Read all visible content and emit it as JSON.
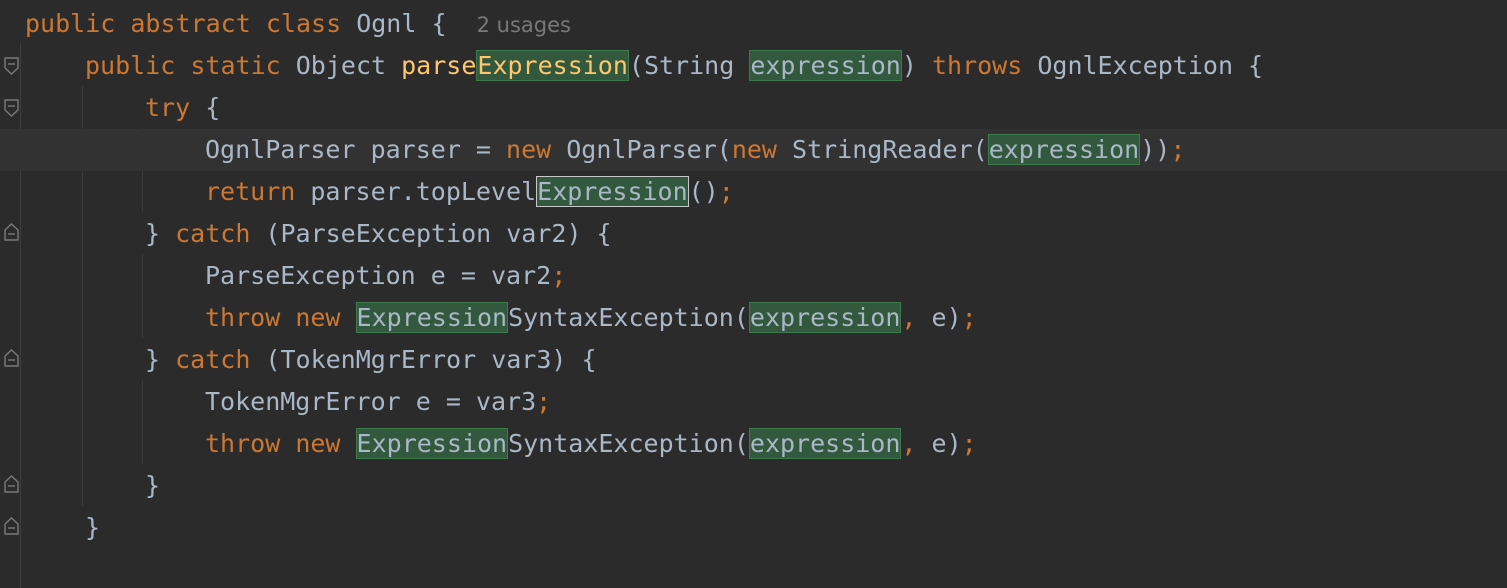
{
  "editor": {
    "class_line": {
      "kw1": "public",
      "kw2": "abstract",
      "kw3": "class",
      "name": "Ognl",
      "brace": "{",
      "usages": "2 usages"
    },
    "method_line": {
      "kw1": "public",
      "kw2": "static",
      "type": "Object",
      "fn_part1": "parse",
      "fn_part2": "Expression",
      "paren_open": "(String ",
      "param": "expression",
      "paren_close": ")",
      "kw_throws": "throws",
      "exc": "OgnlException {"
    },
    "try_line": {
      "kw": "try",
      "brace": "{"
    },
    "parser_line": {
      "p1": "OgnlParser parser = ",
      "kw_new1": "new",
      "p2": " OgnlParser(",
      "kw_new2": "new",
      "p3": " StringReader(",
      "arg": "expression",
      "p4": "))",
      "semi": ";"
    },
    "return_line": {
      "kw": "return",
      "p1": " parser.topLevel",
      "hl": "Expression",
      "p2": "()",
      "semi": ";"
    },
    "catch1_line": {
      "brace": "} ",
      "kw": "catch",
      "rest": " (ParseException var2) {"
    },
    "pe_line": {
      "text": "ParseException e = var2",
      "semi": ";"
    },
    "throw1_line": {
      "kw_throw": "throw",
      "kw_new": "new",
      "hl": "Expression",
      "p1": "SyntaxException(",
      "arg": "expression",
      "comma": ",",
      "p2": " e)",
      "semi": ";"
    },
    "catch2_line": {
      "brace": "} ",
      "kw": "catch",
      "rest": " (TokenMgrError var3) {"
    },
    "tme_line": {
      "text": "TokenMgrError e = var3",
      "semi": ";"
    },
    "throw2_line": {
      "kw_throw": "throw",
      "kw_new": "new",
      "hl": "Expression",
      "p1": "SyntaxException(",
      "arg": "expression",
      "comma": ",",
      "p2": " e)",
      "semi": ";"
    },
    "close_inner": "}",
    "close_method": "}"
  },
  "colors": {
    "background": "#2b2b2b",
    "keyword": "#cc7832",
    "function": "#ffc66d",
    "text": "#a9b7c6",
    "highlight": "#32593d",
    "current_line": "#323232"
  },
  "icons": [
    "fold-open-icon",
    "fold-close-icon"
  ]
}
